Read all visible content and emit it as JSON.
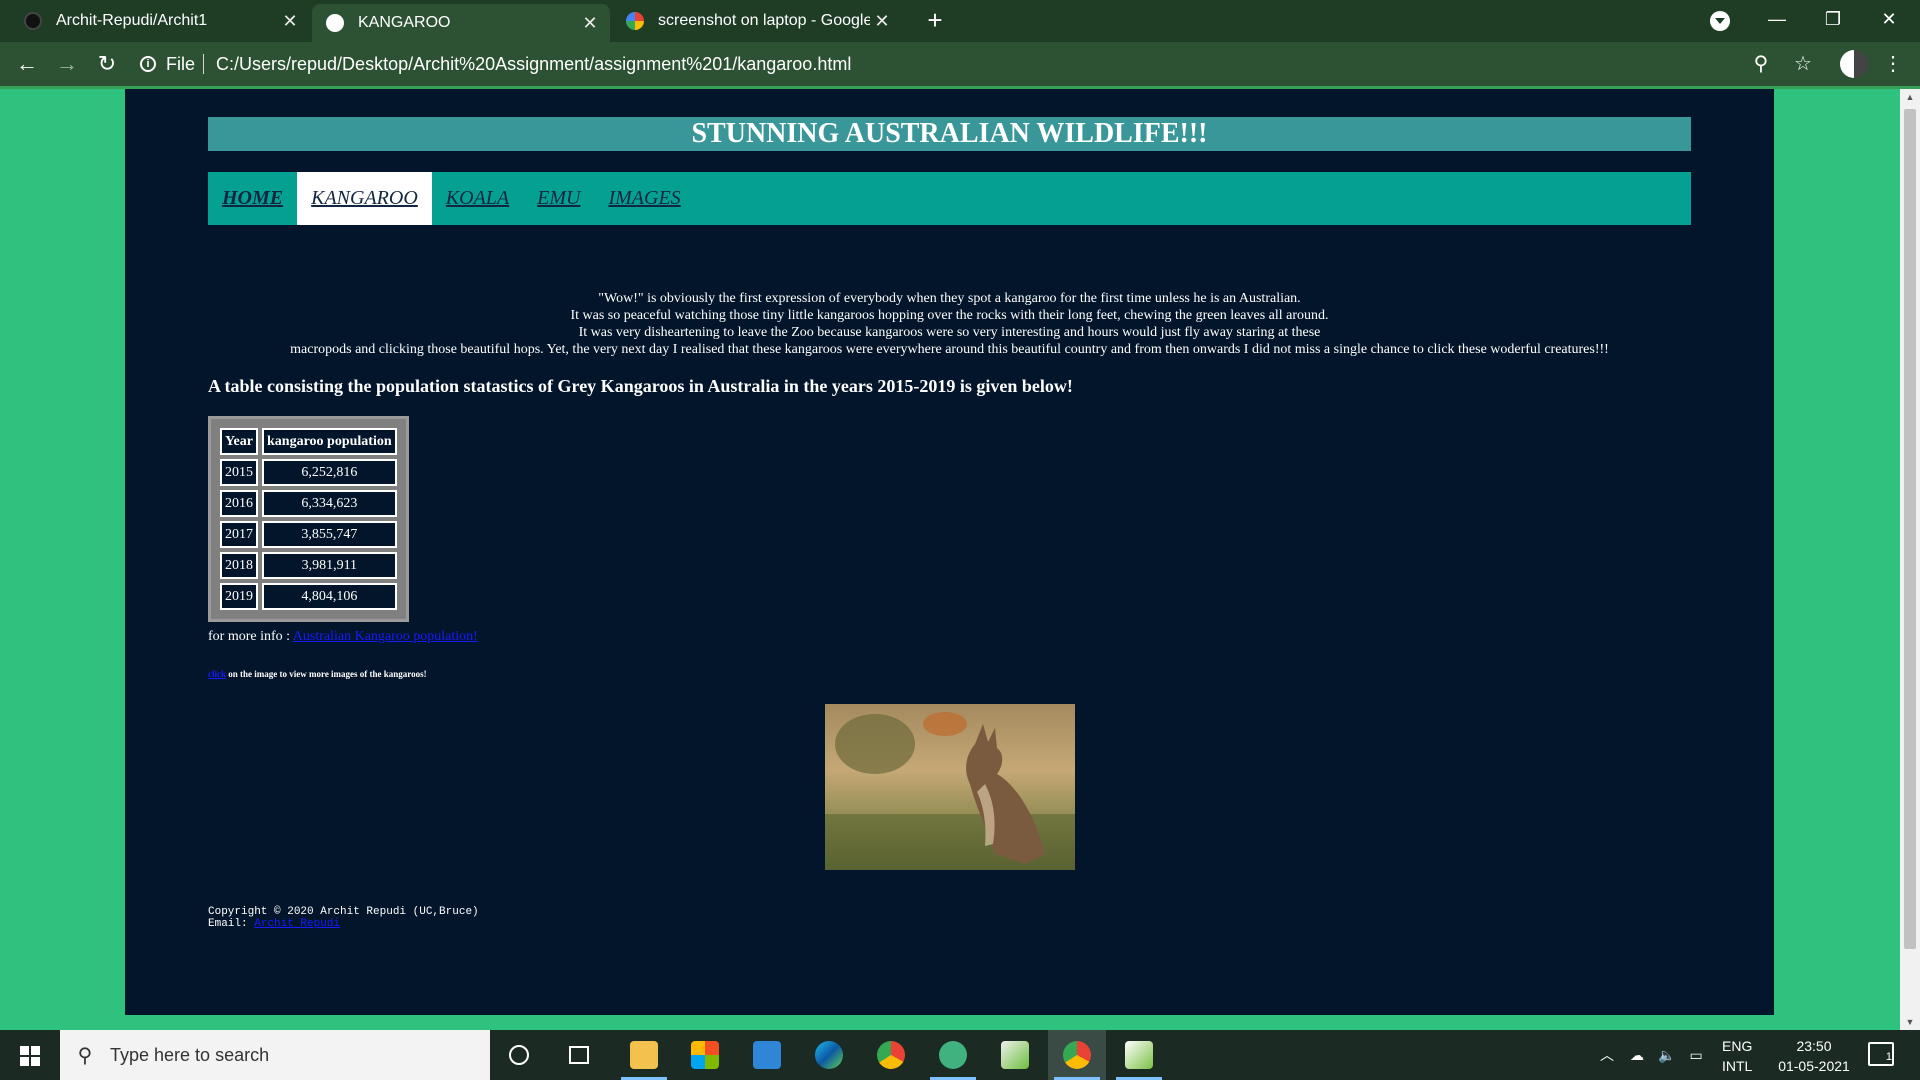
{
  "browser": {
    "tabs": [
      {
        "title": "Archit-Repudi/Archit1",
        "active": false
      },
      {
        "title": "KANGAROO",
        "active": true
      },
      {
        "title": "screenshot on laptop - Google Se",
        "active": false
      }
    ],
    "file_label": "File",
    "url": "C:/Users/repud/Desktop/Archit%20Assignment/assignment%201/kangaroo.html"
  },
  "page": {
    "title": "STUNNING AUSTRALIAN WILDLIFE!!!",
    "nav": [
      "HOME",
      "KANGAROO",
      "KOALA",
      "EMU",
      "IMAGES"
    ],
    "intro_lines": [
      "\"Wow!\" is obviously the first expression of everybody when they spot a kangaroo for the first time unless he is an Australian.",
      "It was so peaceful watching those tiny little kangaroos hopping over the rocks with their long feet, chewing the green leaves all around.",
      "It was very disheartening to leave the Zoo because kangaroos were so very interesting and hours would just fly away staring at these",
      "macropods and clicking those beautiful hops. Yet, the very next day I realised that these kangaroos were everywhere around this beautiful country and from then onwards I did not miss a single chance to click these woderful creatures!!!"
    ],
    "table_heading": "A table consisting the population statastics of Grey Kangaroos in Australia in the years 2015-2019 is given below!",
    "table": {
      "headers": [
        "Year",
        "kangaroo population"
      ],
      "rows": [
        [
          "2015",
          "6,252,816"
        ],
        [
          "2016",
          "6,334,623"
        ],
        [
          "2017",
          "3,855,747"
        ],
        [
          "2018",
          "3,981,911"
        ],
        [
          "2019",
          "4,804,106"
        ]
      ]
    },
    "more_info_label": "for more info :",
    "more_info_link": "Australian Kangaroo population!",
    "click_link": "click",
    "click_note": "on the image to view more images of the kangaroos!",
    "footer_copyright": "Copyright © 2020 Archit Repudi (UC,Bruce)",
    "footer_email_label": "Email:",
    "footer_email_link": "Archit Repudi"
  },
  "taskbar": {
    "search_placeholder": "Type here to search",
    "lang_top": "ENG",
    "lang_bottom": "INTL",
    "time": "23:50",
    "date": "01-05-2021",
    "notification_count": "1"
  },
  "colors": {
    "page_bg": "#02152a",
    "title_bar": "#3a9799",
    "nav_bar": "#04a092",
    "outer_bg": "#2ec27e",
    "link": "#1a1aff"
  }
}
